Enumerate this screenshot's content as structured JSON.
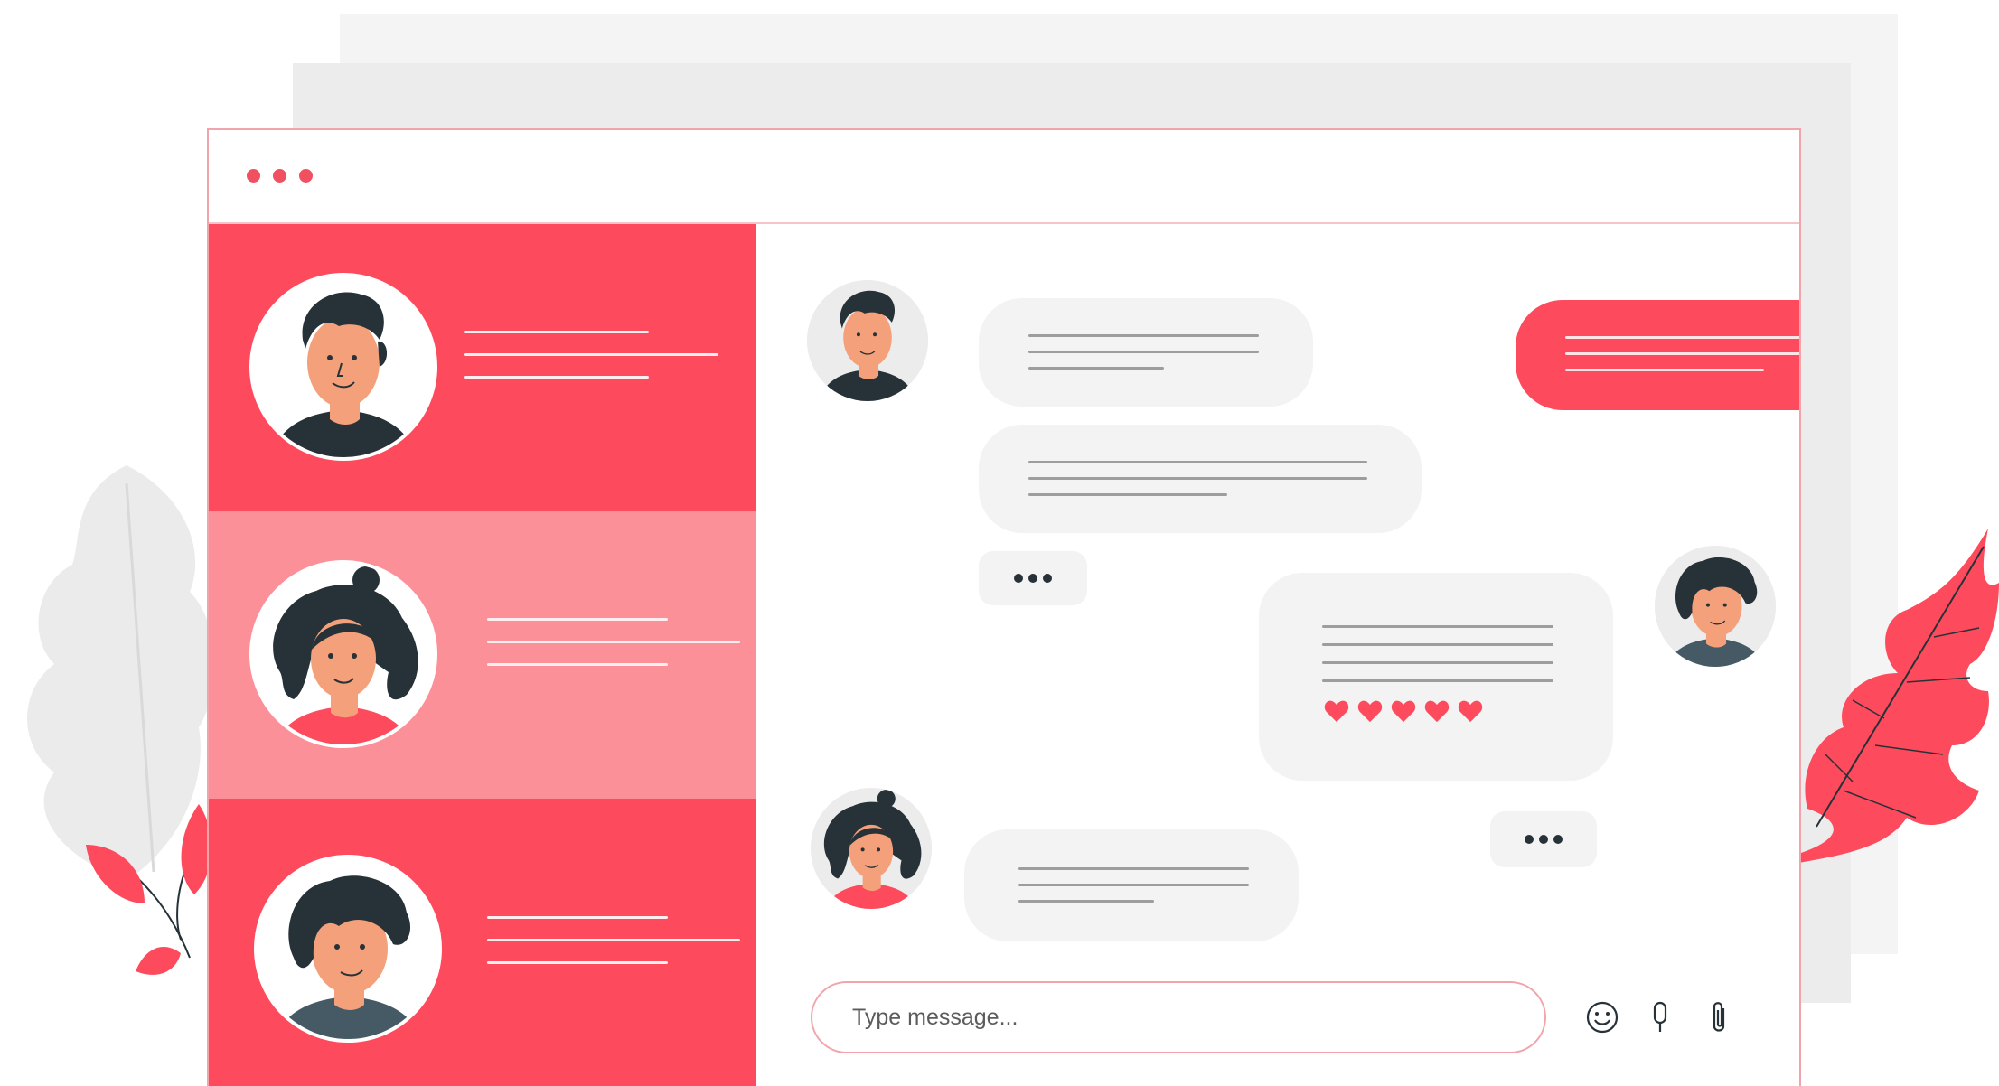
{
  "window": {
    "dots": [
      "dot",
      "dot",
      "dot"
    ]
  },
  "sidebar": {
    "contacts": [
      {
        "avatar": "man-short-hair-avatar",
        "state": "default"
      },
      {
        "avatar": "woman-curly-bun-avatar",
        "state": "selected"
      },
      {
        "avatar": "man-curly-hair-avatar",
        "state": "default"
      }
    ]
  },
  "chat": {
    "typing_indicator": "•••",
    "reaction_hearts": 5,
    "input": {
      "placeholder": "Type message..."
    },
    "tools": [
      "emoji-icon",
      "microphone-icon",
      "attachment-icon"
    ]
  },
  "colors": {
    "accent": "#fd4b5d",
    "accent_light": "#fc9099",
    "bubble_gray": "#f3f3f4",
    "dark_hair": "#263238",
    "skin": "#f4a07a"
  }
}
